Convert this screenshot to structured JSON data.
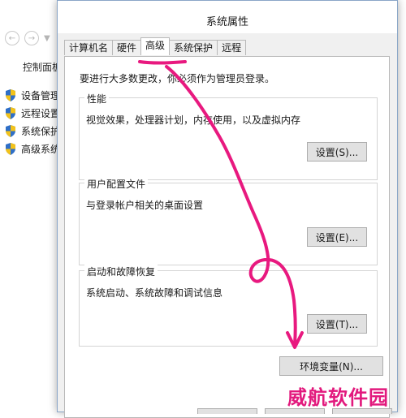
{
  "background": {
    "home_label": "控制面板",
    "links": [
      {
        "label": "设备管理"
      },
      {
        "label": "远程设置"
      },
      {
        "label": "系统保护"
      },
      {
        "label": "高级系统"
      }
    ]
  },
  "dialog": {
    "title": "系统属性",
    "tabs": [
      {
        "label": "计算机名",
        "active": false
      },
      {
        "label": "硬件",
        "active": false
      },
      {
        "label": "高级",
        "active": true
      },
      {
        "label": "系统保护",
        "active": false
      },
      {
        "label": "远程",
        "active": false
      }
    ],
    "admin_note": "要进行大多数更改，你必须作为管理员登录。",
    "groups": [
      {
        "title": "性能",
        "description": "视觉效果，处理器计划，内存使用，以及虚拟内存",
        "button": "设置(S)..."
      },
      {
        "title": "用户配置文件",
        "description": "与登录帐户相关的桌面设置",
        "button": "设置(E)..."
      },
      {
        "title": "启动和故障恢复",
        "description": "系统启动、系统故障和调试信息",
        "button": "设置(T)..."
      }
    ],
    "env_button": "环境变量(N)..."
  },
  "watermark": "威航软件园",
  "colors": {
    "annotation": "#e8197f",
    "dialog_border": "#8aa6c8",
    "panel_bg": "#ffffff",
    "dialog_bg": "#f0f0f0"
  }
}
